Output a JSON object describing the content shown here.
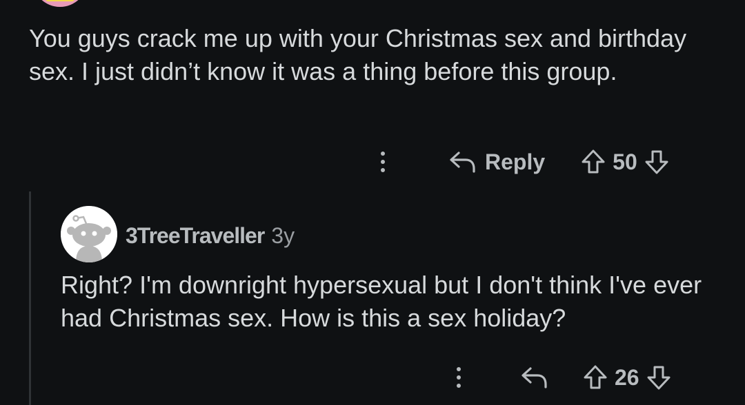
{
  "parent_comment": {
    "body": "You guys crack me up with your Christmas sex and birthday sex. I just didn’t know it was a thing before this group.",
    "actions": {
      "more_icon": "more-vertical-icon",
      "reply_icon": "reply-arrow-icon",
      "reply_label": "Reply",
      "upvote_icon": "upvote-arrow-icon",
      "score": "50",
      "downvote_icon": "downvote-arrow-icon"
    }
  },
  "child_comment": {
    "username": "3TreeTraveller",
    "age": "3y",
    "avatar_icon": "snoo-default-avatar-icon",
    "body": "Right? I'm downright hypersexual but I don't think I've ever had Christmas sex. How is this a sex holiday?",
    "actions": {
      "more_icon": "more-vertical-icon",
      "reply_icon": "reply-arrow-icon",
      "upvote_icon": "upvote-arrow-icon",
      "score": "26",
      "downvote_icon": "downvote-arrow-icon"
    }
  },
  "colors": {
    "background": "#0f1113",
    "text": "#d7dadc",
    "muted": "#b8bcbf",
    "thread_line": "#2f3336"
  }
}
